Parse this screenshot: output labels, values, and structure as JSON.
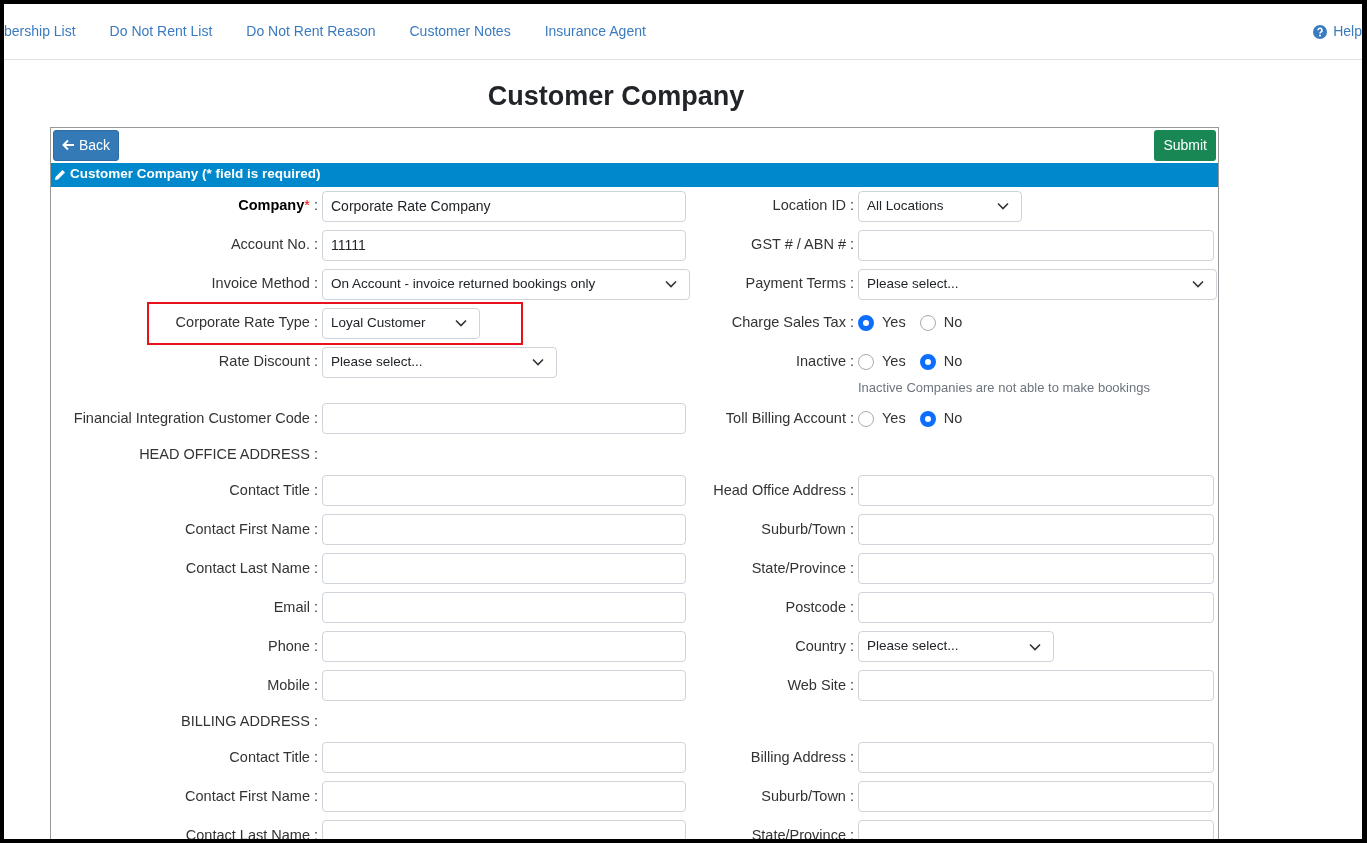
{
  "nav": {
    "items": [
      {
        "label": "bership List"
      },
      {
        "label": "Do Not Rent List"
      },
      {
        "label": "Do Not Rent Reason"
      },
      {
        "label": "Customer Notes"
      },
      {
        "label": "Insurance Agent"
      }
    ],
    "help": "Help"
  },
  "title": "Customer Company",
  "buttons": {
    "back": "Back",
    "submit": "Submit"
  },
  "section_title": "Customer Company (* field is required)",
  "rows": [
    {
      "left": {
        "kind": "text",
        "label": "Company",
        "required_mark": "*",
        "label_end": " :",
        "value": "Corporate Rate Company"
      },
      "right": {
        "kind": "select",
        "label": "Location ID :",
        "value": "All Locations"
      }
    },
    {
      "left": {
        "kind": "text",
        "label": "Account No. :",
        "value": "11111"
      },
      "right": {
        "kind": "text",
        "label": "GST # / ABN # :"
      }
    },
    {
      "left": {
        "kind": "select",
        "label": "Invoice Method :",
        "value": "On Account - invoice returned bookings only"
      },
      "right": {
        "kind": "select",
        "label": "Payment Terms :",
        "value": "Please select..."
      }
    },
    {
      "left": {
        "kind": "select",
        "label": "Corporate Rate Type :",
        "value": "Loyal Customer",
        "highlighted": true
      },
      "right": {
        "kind": "radio",
        "label": "Charge Sales Tax :",
        "options": [
          {
            "label": "Yes",
            "selected": true
          },
          {
            "label": "No",
            "selected": false
          }
        ]
      }
    },
    {
      "left": {
        "kind": "select",
        "label": "Rate Discount :",
        "value": "Please select..."
      },
      "right": {
        "kind": "radio",
        "label": "Inactive :",
        "options": [
          {
            "label": "Yes",
            "selected": false
          },
          {
            "label": "No",
            "selected": true
          }
        ],
        "note": "Inactive Companies are not able to make bookings"
      }
    },
    {
      "left": {
        "kind": "text",
        "label": "Financial Integration Customer Code :"
      },
      "right": {
        "kind": "radio",
        "label": "Toll Billing Account :",
        "options": [
          {
            "label": "Yes",
            "selected": false
          },
          {
            "label": "No",
            "selected": true
          }
        ]
      }
    },
    {
      "left": {
        "kind": "heading",
        "label": "HEAD OFFICE ADDRESS :"
      }
    },
    {
      "left": {
        "kind": "text",
        "label": "Contact Title :"
      },
      "right": {
        "kind": "text",
        "label": "Head Office Address :"
      }
    },
    {
      "left": {
        "kind": "text",
        "label": "Contact First Name :"
      },
      "right": {
        "kind": "text",
        "label": "Suburb/Town :"
      }
    },
    {
      "left": {
        "kind": "text",
        "label": "Contact Last Name :"
      },
      "right": {
        "kind": "text",
        "label": "State/Province :"
      }
    },
    {
      "left": {
        "kind": "text",
        "label": "Email :"
      },
      "right": {
        "kind": "text",
        "label": "Postcode :"
      }
    },
    {
      "left": {
        "kind": "text",
        "label": "Phone :"
      },
      "right": {
        "kind": "select",
        "label": "Country :",
        "value": "Please select..."
      }
    },
    {
      "left": {
        "kind": "text",
        "label": "Mobile :"
      },
      "right": {
        "kind": "text",
        "label": "Web Site :"
      }
    },
    {
      "left": {
        "kind": "heading",
        "label": "BILLING ADDRESS :"
      }
    },
    {
      "left": {
        "kind": "text",
        "label": "Contact Title :"
      },
      "right": {
        "kind": "text",
        "label": "Billing Address :"
      }
    },
    {
      "left": {
        "kind": "text",
        "label": "Contact First Name :"
      },
      "right": {
        "kind": "text",
        "label": "Suburb/Town :"
      }
    },
    {
      "left": {
        "kind": "text",
        "label": "Contact Last Name :"
      },
      "right": {
        "kind": "text",
        "label": "State/Province :"
      }
    }
  ]
}
